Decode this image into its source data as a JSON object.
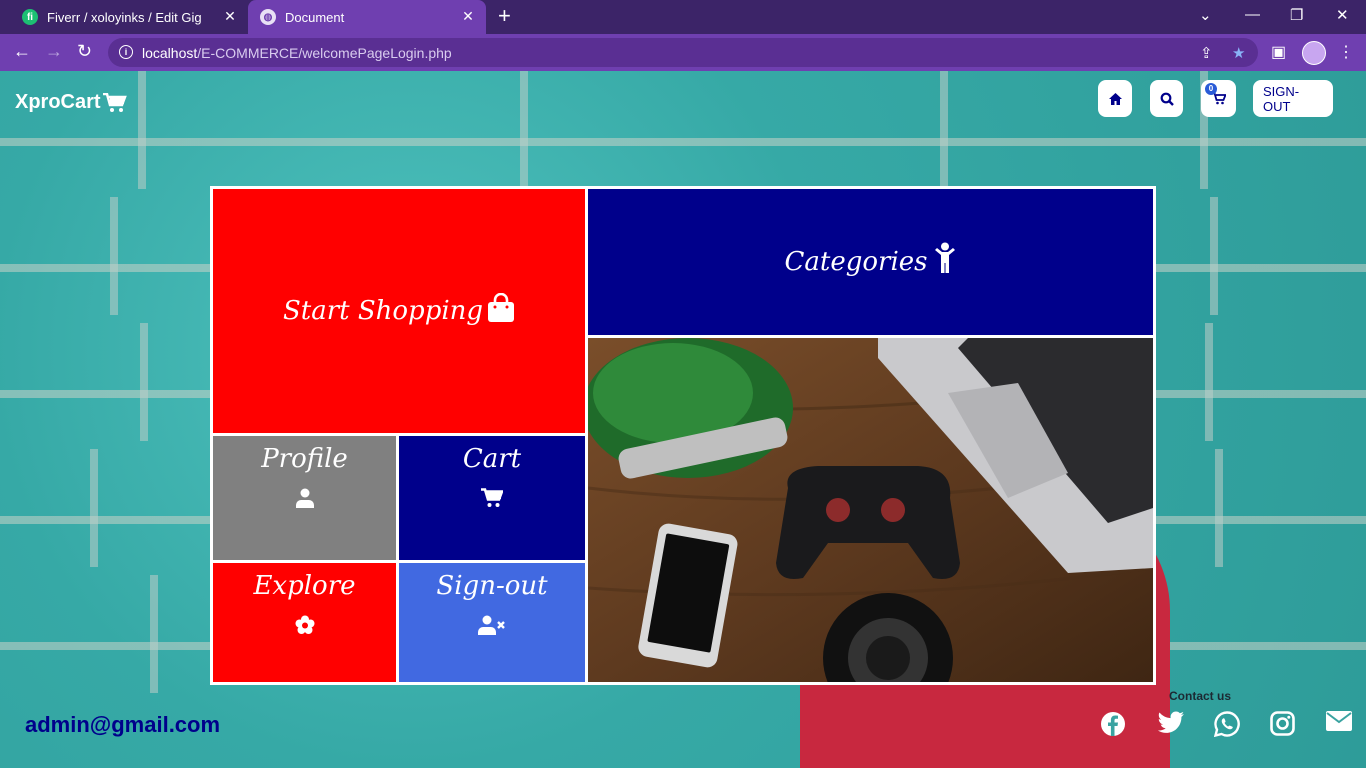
{
  "browser": {
    "tabs": [
      {
        "title": "Fiverr / xoloyinks / Edit Gig",
        "icon": "fiverr-icon",
        "active": false
      },
      {
        "title": "Document",
        "icon": "globe-icon",
        "active": true
      }
    ],
    "url_host": "localhost",
    "url_path": "/E-COMMERCE/welcomePageLogin.php"
  },
  "header": {
    "logo_text": "XproCart",
    "cart_count": "0",
    "signout_label": "SIGN-OUT"
  },
  "tiles": {
    "start_shopping": "Start Shopping",
    "categories": "Categories",
    "profile": "Profile",
    "cart": "Cart",
    "explore": "Explore",
    "signout": "Sign-out"
  },
  "footer": {
    "email": "admin@gmail.com",
    "contact_label": "Contact us",
    "social": [
      "facebook-icon",
      "twitter-icon",
      "whatsapp-icon",
      "instagram-icon",
      "mail-icon"
    ]
  },
  "colors": {
    "red_tile": "#ff0000",
    "navy_tile": "#00008b",
    "gray_tile": "#808080",
    "blue_tile": "#4169e1",
    "browser_purple": "#6f3fb0"
  }
}
